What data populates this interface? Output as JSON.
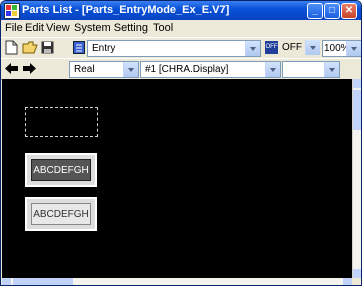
{
  "window": {
    "title": "Parts List - [Parts_EntryMode_Ex_E.V7]",
    "min_glyph": "_",
    "max_glyph": "□",
    "close_glyph": "✕"
  },
  "menu": [
    {
      "label": "File"
    },
    {
      "label": "Edit"
    },
    {
      "label": "View"
    },
    {
      "label": "System Setting"
    },
    {
      "label": "Tool"
    }
  ],
  "toolbar1": {
    "mode_value": "Entry",
    "off_badge": "OFF",
    "off_value": "OFF",
    "zoom_value": "100%"
  },
  "toolbar2": {
    "type_value": "Real",
    "display_value": "#1 [CHRA.Display]",
    "extra_value": ""
  },
  "canvas": {
    "background": "#000000",
    "parts": [
      {
        "text": "ABCDEFGH",
        "style": "dark"
      },
      {
        "text": "ABCDEFGH",
        "style": "light"
      }
    ]
  },
  "colors": {
    "title_bar": "#0a52d8",
    "canvas": "#000000"
  }
}
